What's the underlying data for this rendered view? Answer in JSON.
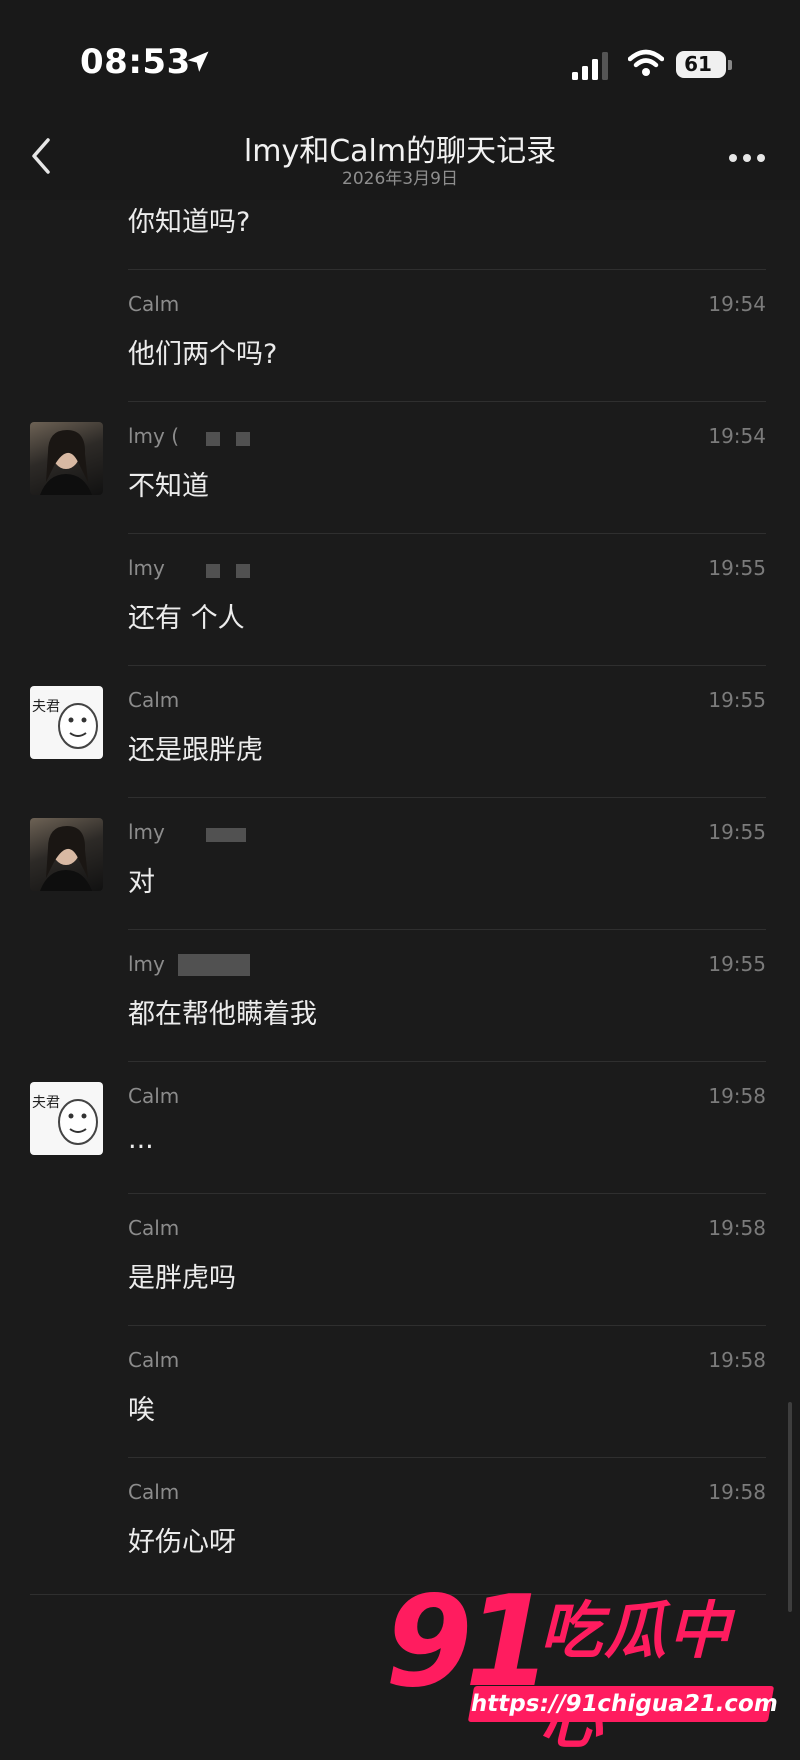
{
  "status_bar": {
    "time": "08:53",
    "battery": "61"
  },
  "nav": {
    "title": "lmy和Calm的聊天记录",
    "subtitle": "2026年3月9日"
  },
  "messages": [
    {
      "sender": "",
      "time": "",
      "text": "你知道吗?"
    },
    {
      "sender": "Calm",
      "time": "19:54",
      "text": "他们两个吗?"
    },
    {
      "sender": "lmy (",
      "time": "19:54",
      "text": "不知道"
    },
    {
      "sender": "lmy",
      "time": "19:55",
      "text": "还有 个人"
    },
    {
      "sender": "Calm",
      "time": "19:55",
      "text": "还是跟胖虎"
    },
    {
      "sender": "lmy",
      "time": "19:55",
      "text": "对"
    },
    {
      "sender": "lmy",
      "time": "19:55",
      "text": "都在帮他瞒着我"
    },
    {
      "sender": "Calm",
      "time": "19:58",
      "text": "..."
    },
    {
      "sender": "Calm",
      "time": "19:58",
      "text": "是胖虎吗"
    },
    {
      "sender": "Calm",
      "time": "19:58",
      "text": "唉"
    },
    {
      "sender": "Calm",
      "time": "19:58",
      "text": "好伤心呀"
    }
  ],
  "avatars": {
    "sticker_text": "夫君"
  },
  "watermark": {
    "number": "91",
    "brand": "吃瓜中心",
    "url": "https://91chigua21.com"
  },
  "colors": {
    "accent": "#ff1c5f",
    "background": "#1b1b1b"
  },
  "icons": [
    "location-arrow-icon",
    "signal-icon",
    "wifi-icon",
    "battery-icon",
    "back-chevron-icon",
    "more-icon"
  ]
}
